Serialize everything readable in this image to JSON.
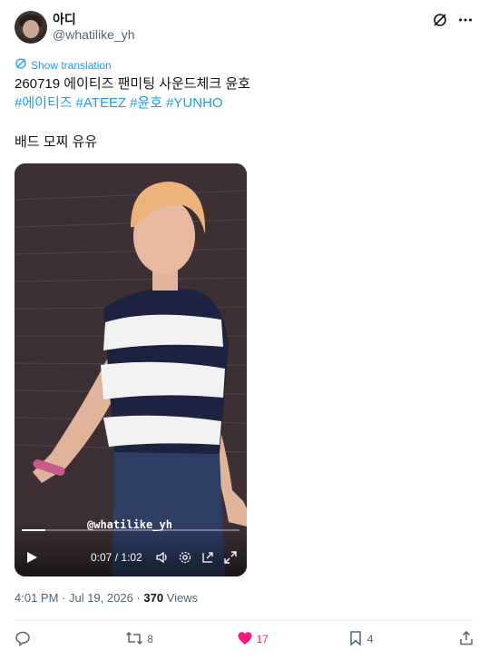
{
  "author": {
    "display_name": "아디",
    "handle": "@whatilike_yh"
  },
  "header_icons": [
    "grok-icon",
    "more-icon"
  ],
  "translate_label": "Show translation",
  "tweet": {
    "line1": "260719 에이티즈 팬미팅 사운드체크 윤호",
    "hashtags": [
      "#에이티즈",
      "#ATEEZ",
      "#윤호",
      "#YUNHO"
    ],
    "line3": "배드 모찌 유유"
  },
  "video": {
    "watermark": "@whatilike_yh",
    "time": "0:07 / 1:02",
    "progress": 0.11,
    "icons": [
      "play-icon",
      "volume-icon",
      "settings-icon",
      "picture-in-picture-icon",
      "fullscreen-icon"
    ]
  },
  "meta": {
    "timestamp": "4:01 PM · Jul 19, 2026 · ",
    "views_count": "370",
    "views_label": " Views"
  },
  "actions": {
    "reply": "",
    "retweets": "8",
    "likes": "17",
    "bookmarks": "4"
  },
  "colors": {
    "accent": "#1d9bf0",
    "like": "#f91880",
    "muted": "#536471",
    "text": "#0f1419"
  }
}
